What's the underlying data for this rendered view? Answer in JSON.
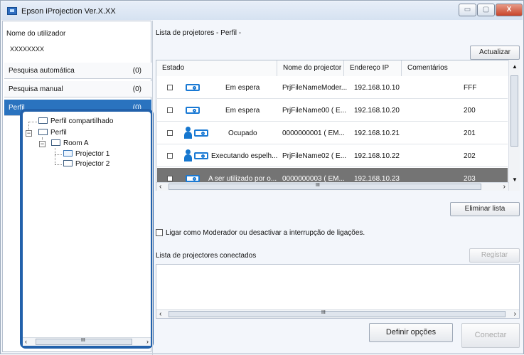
{
  "window": {
    "title": "Epson iProjection Ver.X.XX",
    "controls": [
      "minimize-icon",
      "maximize-icon",
      "close-icon"
    ],
    "control_glyphs": {
      "minimize": "▭",
      "maximize": "▢",
      "close": "X"
    }
  },
  "left": {
    "user_label": "Nome do utilizador",
    "user_value": "XXXXXXXX",
    "search_items": [
      {
        "label": "Pesquisa automática",
        "count": "(0)"
      },
      {
        "label": "Pesquisa manual",
        "count": "(0)"
      },
      {
        "label": "Perfil",
        "count": "(0)"
      }
    ],
    "tree": {
      "shared": "Perfil compartilhado",
      "profile": "Perfil",
      "room": "Room A",
      "projector1": "Projector 1",
      "projector2": "Projector 2"
    },
    "scroll_mark": "III"
  },
  "right": {
    "list_title": "Lista de projetores - Perfil -",
    "refresh": "Actualizar",
    "columns": [
      "Estado",
      "Nome do projector",
      "Endereço IP",
      "Comentários"
    ],
    "rows": [
      {
        "state": "Em espera",
        "name": "PrjFileNameModer...",
        "ip": "192.168.10.10",
        "comment": "FFF"
      },
      {
        "state": "Em espera",
        "name": "PrjFileName00 ( E...",
        "ip": "192.168.10.20",
        "comment": "200"
      },
      {
        "state": "Ocupado",
        "name": "0000000001 ( EM...",
        "ip": "192.168.10.21",
        "comment": "201"
      },
      {
        "state": "Executando espelh...",
        "name": "PrjFileName02 ( E...",
        "ip": "192.168.10.22",
        "comment": "202"
      },
      {
        "state": "A ser utilizado por o...",
        "name": "0000000003 ( EM...",
        "ip": "192.168.10.23",
        "comment": "203"
      }
    ],
    "grid_scroll_mark": "III",
    "delete_list": "Eliminar lista",
    "moderator_text": "Ligar como Moderador ou desactivar a interrupção de ligações.",
    "connected_title": "Lista de projectores conectados",
    "register": "Registar",
    "connected_scroll_mark": "III",
    "options": "Definir opções",
    "connect": "Conectar"
  },
  "colors": {
    "selected": "#2a73bf",
    "highlight": "#2261ab",
    "row_selected": "#747474"
  }
}
